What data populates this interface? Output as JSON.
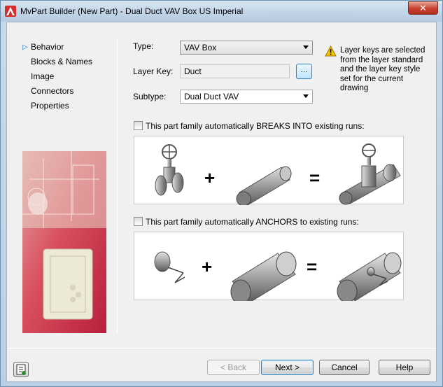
{
  "window": {
    "title": "MvPart Builder (New Part) - Dual Duct VAV Box US Imperial",
    "close_glyph": "✕"
  },
  "nav": {
    "items": [
      {
        "label": "Behavior",
        "active": true
      },
      {
        "label": "Blocks & Names"
      },
      {
        "label": "Image"
      },
      {
        "label": "Connectors"
      },
      {
        "label": "Properties"
      }
    ]
  },
  "form": {
    "type_label": "Type:",
    "type_value": "VAV Box",
    "layer_key_label": "Layer Key:",
    "layer_key_value": "Duct",
    "browse_label": "...",
    "subtype_label": "Subtype:",
    "subtype_value": "Dual Duct VAV",
    "warning_text": "Layer keys are selected from the layer standard and the layer key style set for the current drawing"
  },
  "options": {
    "breaks_into_label": "This part family automatically BREAKS INTO existing runs:",
    "breaks_into_checked": false,
    "anchors_label": "This part family automatically ANCHORS to existing runs:",
    "anchors_checked": false,
    "plus": "+",
    "equals": "="
  },
  "buttons": {
    "back": "< Back",
    "next": "Next >",
    "cancel": "Cancel",
    "help": "Help"
  },
  "colors": {
    "accent": "#1e6fc4",
    "warning": "#f5c400",
    "brand": "#d32f2f"
  }
}
